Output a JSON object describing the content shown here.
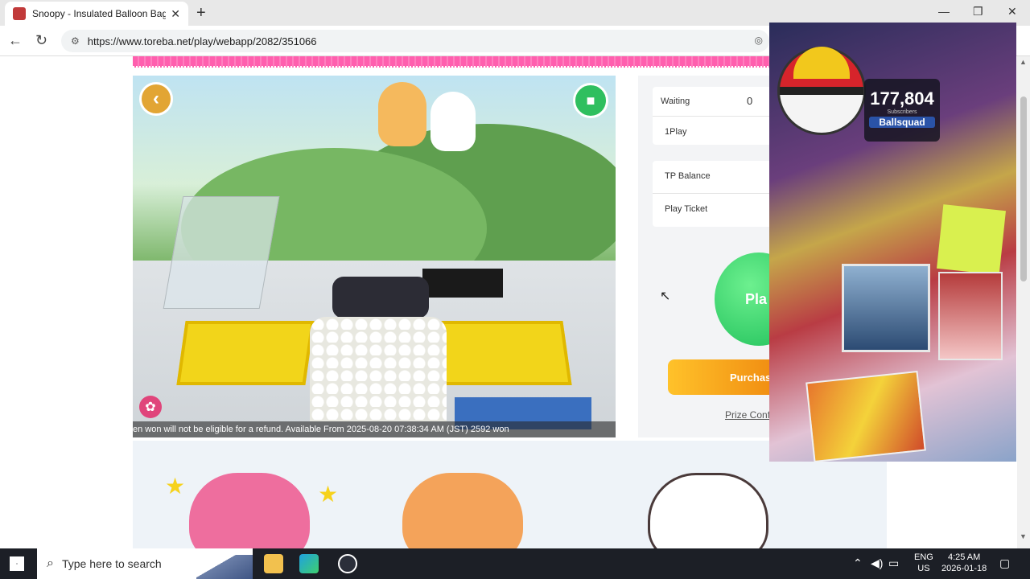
{
  "browser": {
    "tab_title": "Snoopy - Insulated Balloon Bag S",
    "tab_close": "✕",
    "new_tab": "+",
    "url": "https://www.toreba.net/play/webapp/2082/351066",
    "window_controls": {
      "minimize": "—",
      "maximize": "❐",
      "close": "✕"
    }
  },
  "game": {
    "ticker_text": "en won will not be eligible for a refund. Available From 2025-08-20 07:38:34 AM (JST) 2592 won"
  },
  "panel": {
    "waiting_label": "Waiting",
    "waiting_value": "0",
    "oneplay_label": "1Play",
    "tp_balance_label": "TP Balance",
    "play_ticket_label": "Play Ticket",
    "play_button": "Pla",
    "purchase_button": "Purchas",
    "prize_link": "Prize Confi"
  },
  "overlay": {
    "subscriber_count": "177,804",
    "subscriber_label": "Subscribers",
    "channel_name": "Ballsquad"
  },
  "taskbar": {
    "search_placeholder": "Type here to search",
    "lang_top": "ENG",
    "lang_bottom": "US",
    "time": "4:25 AM",
    "date": "2026-01-18"
  },
  "icons": {
    "back": "arrow-left-icon",
    "reload": "reload-icon",
    "site_info": "site-info-icon",
    "tracking": "eye-off-icon",
    "game_back": "chevron-left-icon",
    "camera": "camera-switch-icon",
    "settings": "gear-icon"
  },
  "colors": {
    "pink_accent": "#ff5fae",
    "play_green": "#1fc05a",
    "purchase_orange": "#f08a10",
    "back_button": "#e2a534",
    "settings_pink": "#e0457b"
  }
}
